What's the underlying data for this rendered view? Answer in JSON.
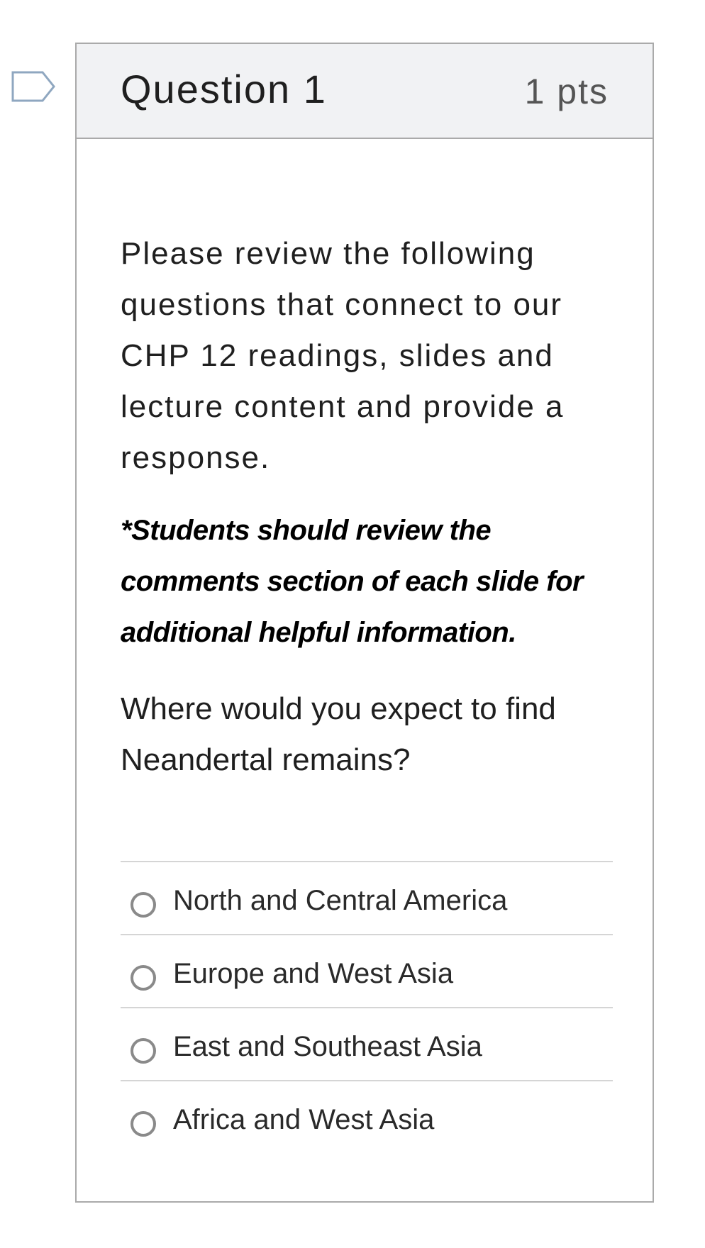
{
  "question": {
    "title": "Question 1",
    "points": "1 pts",
    "prompt": "Please review the following questions that connect to our CHP 12 readings, slides and lecture content and provide a response.",
    "note": "*Students should review the comments section of each slide for additional helpful information.",
    "text": "Where would you expect to find Neandertal remains?",
    "answers": [
      {
        "label": "North and Central America"
      },
      {
        "label": "Europe and West Asia"
      },
      {
        "label": "East and Southeast Asia"
      },
      {
        "label": "Africa and West Asia"
      }
    ]
  },
  "icons": {
    "flag": "flag-question-icon"
  },
  "colors": {
    "header_bg": "#f1f2f4",
    "border": "#aaaaaa",
    "flag_stroke": "#8fa7c0",
    "radio_border": "#8a8a8a"
  }
}
